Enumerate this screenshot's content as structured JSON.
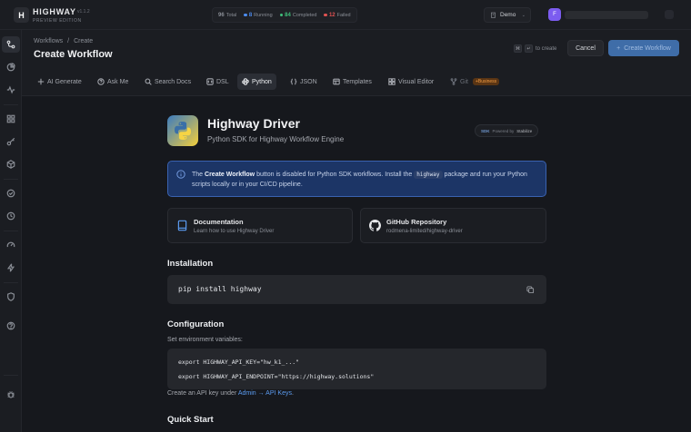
{
  "app": {
    "logo_letter": "H",
    "brand": "HIGHWAY",
    "version": "v1.1.2",
    "edition": "PREVIEW EDITION"
  },
  "stats": {
    "total_value": "96",
    "total_label": "Total",
    "running_value": "8",
    "running_label": "Running",
    "completed_value": "84",
    "completed_label": "Completed",
    "failed_value": "12",
    "failed_label": "Failed",
    "colors": {
      "running": "#4c8cf0",
      "completed": "#3fbf7a",
      "failed": "#e05252"
    }
  },
  "workspace": {
    "label": "Demo"
  },
  "user": {
    "initial": "F"
  },
  "sidebar": {
    "items": [
      {
        "name": "workflows",
        "icon": "workflow-icon",
        "active": true
      },
      {
        "name": "analytics",
        "icon": "pie-chart-icon"
      },
      {
        "name": "activity",
        "icon": "activity-icon"
      },
      {
        "name": "apps",
        "icon": "grid-icon"
      },
      {
        "name": "keys",
        "icon": "key-icon"
      },
      {
        "name": "packages",
        "icon": "package-icon"
      },
      {
        "name": "tasks",
        "icon": "check-circle-icon"
      },
      {
        "name": "schedules",
        "icon": "clock-icon"
      },
      {
        "name": "performance",
        "icon": "gauge-icon"
      },
      {
        "name": "triggers",
        "icon": "zap-icon"
      },
      {
        "name": "security",
        "icon": "shield-icon"
      },
      {
        "name": "help",
        "icon": "help-icon"
      },
      {
        "name": "debug",
        "icon": "bug-icon"
      }
    ]
  },
  "header": {
    "breadcrumb_workflows": "Workflows",
    "breadcrumb_sep": "/",
    "breadcrumb_create": "Create",
    "title": "Create Workflow",
    "shortcut_key1": "⌘",
    "shortcut_key2": "↵",
    "shortcut_label": "to create",
    "cancel_label": "Cancel",
    "create_label": "Create Workflow"
  },
  "tabs": [
    {
      "label": "AI Generate",
      "icon": "sparkle-icon"
    },
    {
      "label": "Ask Me",
      "icon": "help-circle-icon"
    },
    {
      "label": "Search Docs",
      "icon": "search-icon"
    },
    {
      "label": "DSL",
      "icon": "code-block-icon"
    },
    {
      "label": "Python",
      "icon": "python-icon",
      "active": true
    },
    {
      "label": "JSON",
      "icon": "braces-icon"
    },
    {
      "label": "Templates",
      "icon": "template-icon"
    },
    {
      "label": "Visual Editor",
      "icon": "layout-icon"
    },
    {
      "label": "Git",
      "icon": "git-icon",
      "badge": "+Business"
    }
  ],
  "sdk": {
    "title": "Highway Driver",
    "subtitle": "Python SDK for Highway Workflow Engine",
    "powered_chip": "SDK",
    "powered_text": "Powered by",
    "powered_lib": "Stabilize"
  },
  "info": {
    "text_before": "The ",
    "bold": "Create Workflow",
    "text_mid": " button is disabled for Python SDK workflows. Install the ",
    "code": "highway",
    "text_after": " package and run your Python scripts locally or in your CI/CD pipeline."
  },
  "cards": {
    "docs_title": "Documentation",
    "docs_sub": "Learn how to use Highway Driver",
    "github_title": "GitHub Repository",
    "github_sub": "rodmena-limited/highway-driver"
  },
  "installation": {
    "title": "Installation",
    "command": "pip install highway"
  },
  "configuration": {
    "title": "Configuration",
    "subtitle": "Set environment variables:",
    "line1": "export HIGHWAY_API_KEY=\"hw_k1_...\"",
    "line2": "export HIGHWAY_API_ENDPOINT=\"https://highway.solutions\"",
    "api_key_text": "Create an API key under ",
    "api_key_link": "Admin → API Keys",
    "api_key_end": "."
  },
  "quickstart": {
    "title": "Quick Start"
  }
}
